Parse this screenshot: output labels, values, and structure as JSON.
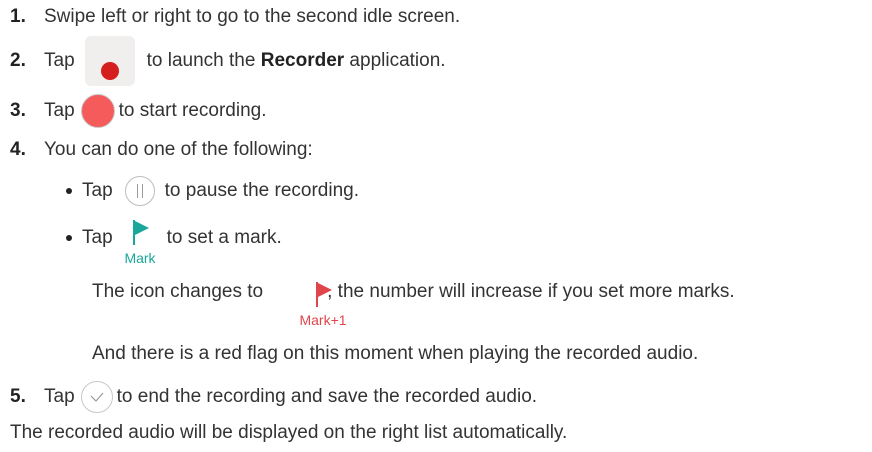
{
  "steps": [
    {
      "num": "1.",
      "text": "Swipe left or right to go to the second idle screen."
    },
    {
      "num": "2.",
      "pre": "Tap",
      "post_a": "to launch the ",
      "bold": "Recorder",
      "post_b": " application.",
      "icon": "recorder-app-icon"
    },
    {
      "num": "3.",
      "pre": "Tap",
      "post": "to start recording.",
      "icon": "record-button-icon"
    },
    {
      "num": "4.",
      "text": "You can do one of the following:"
    },
    {
      "num": "5.",
      "pre": "Tap",
      "post": "to end the recording and save the recorded audio.",
      "icon": "check-circle-icon"
    }
  ],
  "bullets": [
    {
      "pre": "Tap",
      "post": "to pause the recording.",
      "icon": "pause-icon"
    },
    {
      "pre": "Tap",
      "post": "to set a mark.",
      "icon": "mark-flag-icon",
      "icon_label": "Mark"
    }
  ],
  "mark_note": {
    "pre": "The icon changes to",
    "post": ", the number will increase if you set more marks.",
    "icon": "mark-flag-red-icon",
    "icon_label": "Mark+1"
  },
  "red_flag_note": "And there is a red flag on this moment when playing the recorded audio.",
  "footer": "The recorded audio will be displayed on the right list automatically.",
  "colors": {
    "teal_flag": "#1aa79b",
    "red_flag": "#e0454c",
    "record_red": "#f55b5b",
    "recorder_dot": "#d51e1e"
  }
}
